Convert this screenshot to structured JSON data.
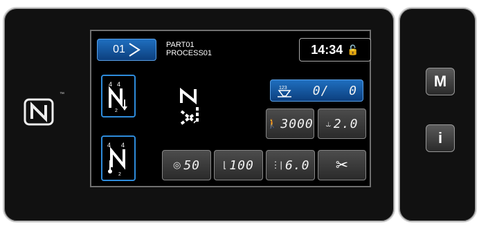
{
  "header": {
    "pattern_button_label": "01",
    "part": "PART01",
    "process": "PROCESS01",
    "time": "14:34",
    "lock_icon": "unlock-icon"
  },
  "counter": {
    "value": "0/",
    "total": "0"
  },
  "speed": {
    "value": "3000"
  },
  "stitch_length": {
    "value": "2.0"
  },
  "thread_tension": {
    "value": "50"
  },
  "presser_foot": {
    "value": "100"
  },
  "condensation": {
    "value": "6.0"
  },
  "stitch_pattern_digits": {
    "top_left": "4",
    "top_right": "4",
    "bottom": "2"
  },
  "stitch_pattern_digits_2": {
    "top_left": "4",
    "top_right": "4",
    "bottom": "2"
  },
  "side": {
    "menu_label": "M",
    "info_label": "i"
  },
  "colors": {
    "accent": "#2e8cdc",
    "screen_bg": "#000000",
    "bezel": "#111111"
  }
}
